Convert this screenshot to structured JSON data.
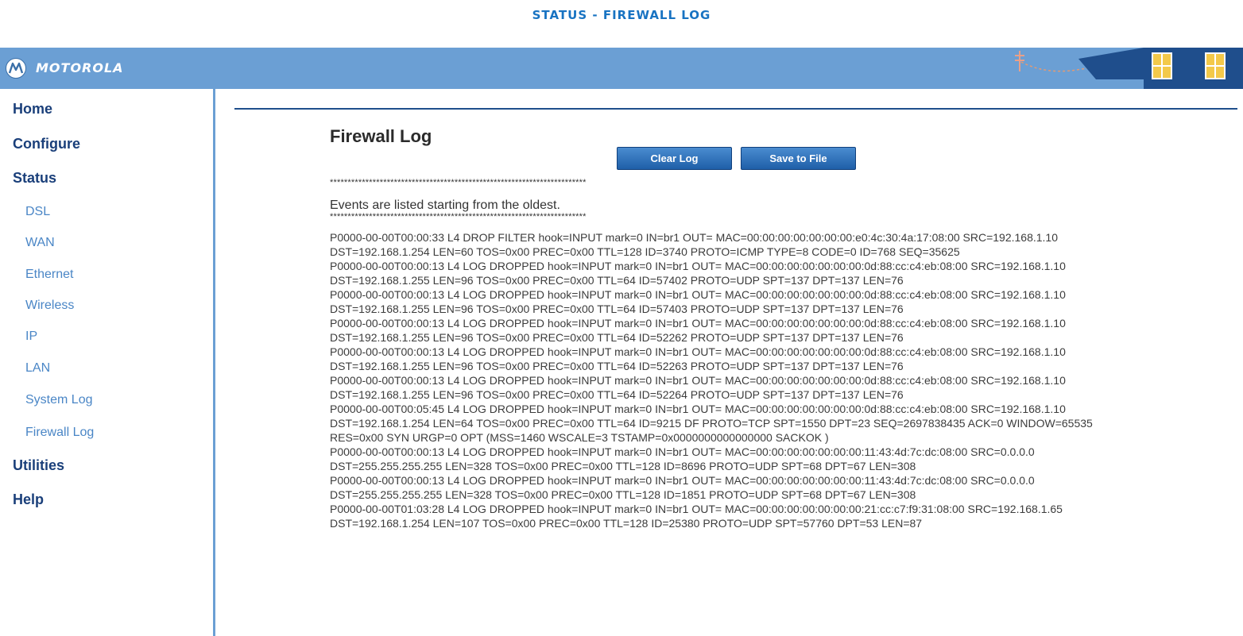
{
  "page_caption": "STATUS - FIREWALL LOG",
  "brand": {
    "name": "MOTOROLA"
  },
  "sidebar": {
    "items": [
      {
        "label": "Home",
        "level": "top"
      },
      {
        "label": "Configure",
        "level": "top"
      },
      {
        "label": "Status",
        "level": "top"
      },
      {
        "label": "DSL",
        "level": "sub"
      },
      {
        "label": "WAN",
        "level": "sub"
      },
      {
        "label": "Ethernet",
        "level": "sub"
      },
      {
        "label": "Wireless",
        "level": "sub"
      },
      {
        "label": "IP",
        "level": "sub"
      },
      {
        "label": "LAN",
        "level": "sub"
      },
      {
        "label": "System Log",
        "level": "sub"
      },
      {
        "label": "Firewall Log",
        "level": "sub"
      },
      {
        "label": "Utilities",
        "level": "top"
      },
      {
        "label": "Help",
        "level": "top"
      }
    ]
  },
  "main": {
    "title": "Firewall Log",
    "buttons": {
      "clear_log": "Clear Log",
      "save_to_file": "Save to File"
    },
    "separator": "************************************************************************",
    "events_note": "Events are listed starting from the oldest.",
    "log_entries": [
      "P0000-00-00T00:00:33 L4 DROP FILTER hook=INPUT mark=0 IN=br1 OUT= MAC=00:00:00:00:00:00:00:e0:4c:30:4a:17:08:00 SRC=192.168.1.10 DST=192.168.1.254 LEN=60 TOS=0x00 PREC=0x00 TTL=128 ID=3740 PROTO=ICMP TYPE=8 CODE=0 ID=768 SEQ=35625",
      "P0000-00-00T00:00:13 L4 LOG DROPPED hook=INPUT mark=0 IN=br1 OUT= MAC=00:00:00:00:00:00:00:0d:88:cc:c4:eb:08:00 SRC=192.168.1.10 DST=192.168.1.255 LEN=96 TOS=0x00 PREC=0x00 TTL=64 ID=57402 PROTO=UDP SPT=137 DPT=137 LEN=76",
      "P0000-00-00T00:00:13 L4 LOG DROPPED hook=INPUT mark=0 IN=br1 OUT= MAC=00:00:00:00:00:00:00:0d:88:cc:c4:eb:08:00 SRC=192.168.1.10 DST=192.168.1.255 LEN=96 TOS=0x00 PREC=0x00 TTL=64 ID=57403 PROTO=UDP SPT=137 DPT=137 LEN=76",
      "P0000-00-00T00:00:13 L4 LOG DROPPED hook=INPUT mark=0 IN=br1 OUT= MAC=00:00:00:00:00:00:00:0d:88:cc:c4:eb:08:00 SRC=192.168.1.10 DST=192.168.1.255 LEN=96 TOS=0x00 PREC=0x00 TTL=64 ID=52262 PROTO=UDP SPT=137 DPT=137 LEN=76",
      "P0000-00-00T00:00:13 L4 LOG DROPPED hook=INPUT mark=0 IN=br1 OUT= MAC=00:00:00:00:00:00:00:0d:88:cc:c4:eb:08:00 SRC=192.168.1.10 DST=192.168.1.255 LEN=96 TOS=0x00 PREC=0x00 TTL=64 ID=52263 PROTO=UDP SPT=137 DPT=137 LEN=76",
      "P0000-00-00T00:00:13 L4 LOG DROPPED hook=INPUT mark=0 IN=br1 OUT= MAC=00:00:00:00:00:00:00:0d:88:cc:c4:eb:08:00 SRC=192.168.1.10 DST=192.168.1.255 LEN=96 TOS=0x00 PREC=0x00 TTL=64 ID=52264 PROTO=UDP SPT=137 DPT=137 LEN=76",
      "P0000-00-00T00:05:45 L4 LOG DROPPED hook=INPUT mark=0 IN=br1 OUT= MAC=00:00:00:00:00:00:00:0d:88:cc:c4:eb:08:00 SRC=192.168.1.10 DST=192.168.1.254 LEN=64 TOS=0x00 PREC=0x00 TTL=64 ID=9215 DF PROTO=TCP SPT=1550 DPT=23 SEQ=2697838435 ACK=0 WINDOW=65535 RES=0x00 SYN URGP=0 OPT (MSS=1460 WSCALE=3 TSTAMP=0x0000000000000000 SACKOK )",
      "P0000-00-00T00:00:13 L4 LOG DROPPED hook=INPUT mark=0 IN=br1 OUT= MAC=00:00:00:00:00:00:00:11:43:4d:7c:dc:08:00 SRC=0.0.0.0 DST=255.255.255.255 LEN=328 TOS=0x00 PREC=0x00 TTL=128 ID=8696 PROTO=UDP SPT=68 DPT=67 LEN=308",
      "P0000-00-00T00:00:13 L4 LOG DROPPED hook=INPUT mark=0 IN=br1 OUT= MAC=00:00:00:00:00:00:00:11:43:4d:7c:dc:08:00 SRC=0.0.0.0 DST=255.255.255.255 LEN=328 TOS=0x00 PREC=0x00 TTL=128 ID=1851 PROTO=UDP SPT=68 DPT=67 LEN=308",
      "P0000-00-00T01:03:28 L4 LOG DROPPED hook=INPUT mark=0 IN=br1 OUT= MAC=00:00:00:00:00:00:00:21:cc:c7:f9:31:08:00 SRC=192.168.1.65 DST=192.168.1.254 LEN=107 TOS=0x00 PREC=0x00 TTL=128 ID=25380 PROTO=UDP SPT=57760 DPT=53 LEN=87"
    ]
  },
  "colors": {
    "header_bar": "#6b9fd4",
    "caption": "#1873c2",
    "nav_top": "#1a3f7a",
    "nav_sub": "#4a86c6",
    "button": "#2a6db5"
  },
  "icons": {
    "logo": "motorola-logo-icon",
    "header_art": "utility-pole-house-icon"
  }
}
